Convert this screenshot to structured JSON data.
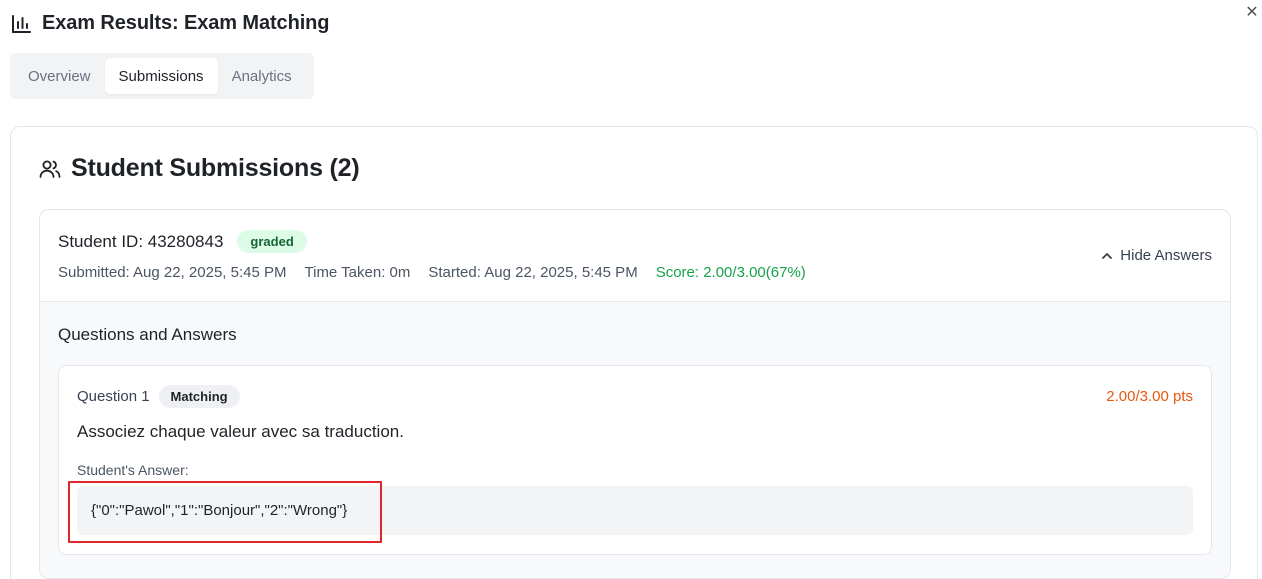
{
  "window": {
    "close_glyph": "✕"
  },
  "header": {
    "title": "Exam Results: Exam Matching",
    "icon": "bar-chart-icon"
  },
  "tabs": [
    {
      "label": "Overview",
      "active": false
    },
    {
      "label": "Submissions",
      "active": true
    },
    {
      "label": "Analytics",
      "active": false
    }
  ],
  "submissions": {
    "title": "Student Submissions (2)",
    "icon": "users-icon",
    "items": [
      {
        "student_id": "Student ID: 43280843",
        "status": "graded",
        "submitted": "Submitted: Aug 22, 2025, 5:45 PM",
        "time_taken": "Time Taken: 0m",
        "started": "Started: Aug 22, 2025, 5:45 PM",
        "score": "Score: 2.00/3.00(67%)",
        "toggle_label": "Hide Answers",
        "qa_title": "Questions and Answers",
        "questions": [
          {
            "label": "Question 1",
            "type": "Matching",
            "points": "2.00/3.00 pts",
            "text": "Associez chaque valeur avec sa traduction.",
            "answer_label": "Student's Answer:",
            "answer_value": "{\"0\":\"Pawol\",\"1\":\"Bonjour\",\"2\":\"Wrong\"}"
          }
        ]
      }
    ]
  },
  "colors": {
    "graded_bg": "#dcfce7",
    "graded_text": "#166534",
    "score": "#16a34a",
    "points": "#ea580c",
    "highlight": "#e0262b"
  }
}
